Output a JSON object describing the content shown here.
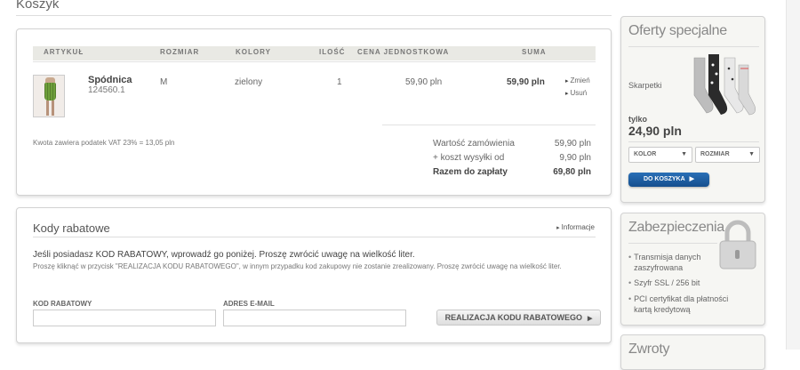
{
  "page": {
    "title": "Koszyk"
  },
  "cart": {
    "headers": {
      "article": "ARTYKUŁ",
      "size": "ROZMIAR",
      "colors": "KOLORY",
      "qty": "ILOŚĆ",
      "unit_price": "CENA JEDNOSTKOWA",
      "total": "SUMA"
    },
    "item": {
      "name": "Spódnica",
      "code": "124560.1",
      "size": "M",
      "color": "zielony",
      "qty": "1",
      "unit_price": "59,90 pln",
      "total": "59,90 pln",
      "change_label": "Zmień",
      "remove_label": "Usuń"
    },
    "vat_note": "Kwota zawiera podatek VAT 23% = 13,05 pln",
    "summary": {
      "order_value_label": "Wartość zamówienia",
      "order_value": "59,90 pln",
      "shipping_label": "+ koszt wysyłki od",
      "shipping": "9,90 pln",
      "total_label": "Razem do zapłaty",
      "total": "69,80 pln"
    }
  },
  "coupon": {
    "title": "Kody rabatowe",
    "info_label": "Informacje",
    "main_text": "Jeśli posiadasz KOD RABATOWY, wprowadź go poniżej. Proszę zwrócić uwagę na wielkość liter.",
    "sub_text": "Proszę kliknąć w przycisk \"REALIZACJA KODU RABATOWEGO\", w innym przypadku kod zakupowy nie zostanie zrealizowany. Proszę zwrócić uwagę na wielkość liter.",
    "code_label": "KOD RABATOWY",
    "email_label": "ADRES E-MAIL",
    "code_value": "",
    "email_value": "",
    "redeem_label": "REALIZACJA KODU RABATOWEGO"
  },
  "offer": {
    "title": "Oferty specjalne",
    "product_name": "Skarpetki",
    "only_label": "tylko",
    "price": "24,90 pln",
    "color_select": "KOLOR",
    "size_select": "ROZMIAR",
    "add_to_cart_label": "DO KOSZYKA"
  },
  "security": {
    "title": "Zabezpieczenia",
    "items": [
      "Transmisja danych zaszyfrowana",
      "Szyfr SSL / 256 bit",
      "PCI certyfikat dla płatności kartą kredytową"
    ]
  },
  "returns": {
    "title": "Zwroty"
  },
  "icons": [
    "arrow-right-icon",
    "chevron-down-icon",
    "padlock-icon",
    "bullet-icon"
  ],
  "colors": {
    "button_blue": "#1d5fa3",
    "panel_bg": "#f6f6f3",
    "header_bg": "#e9e9e4"
  }
}
